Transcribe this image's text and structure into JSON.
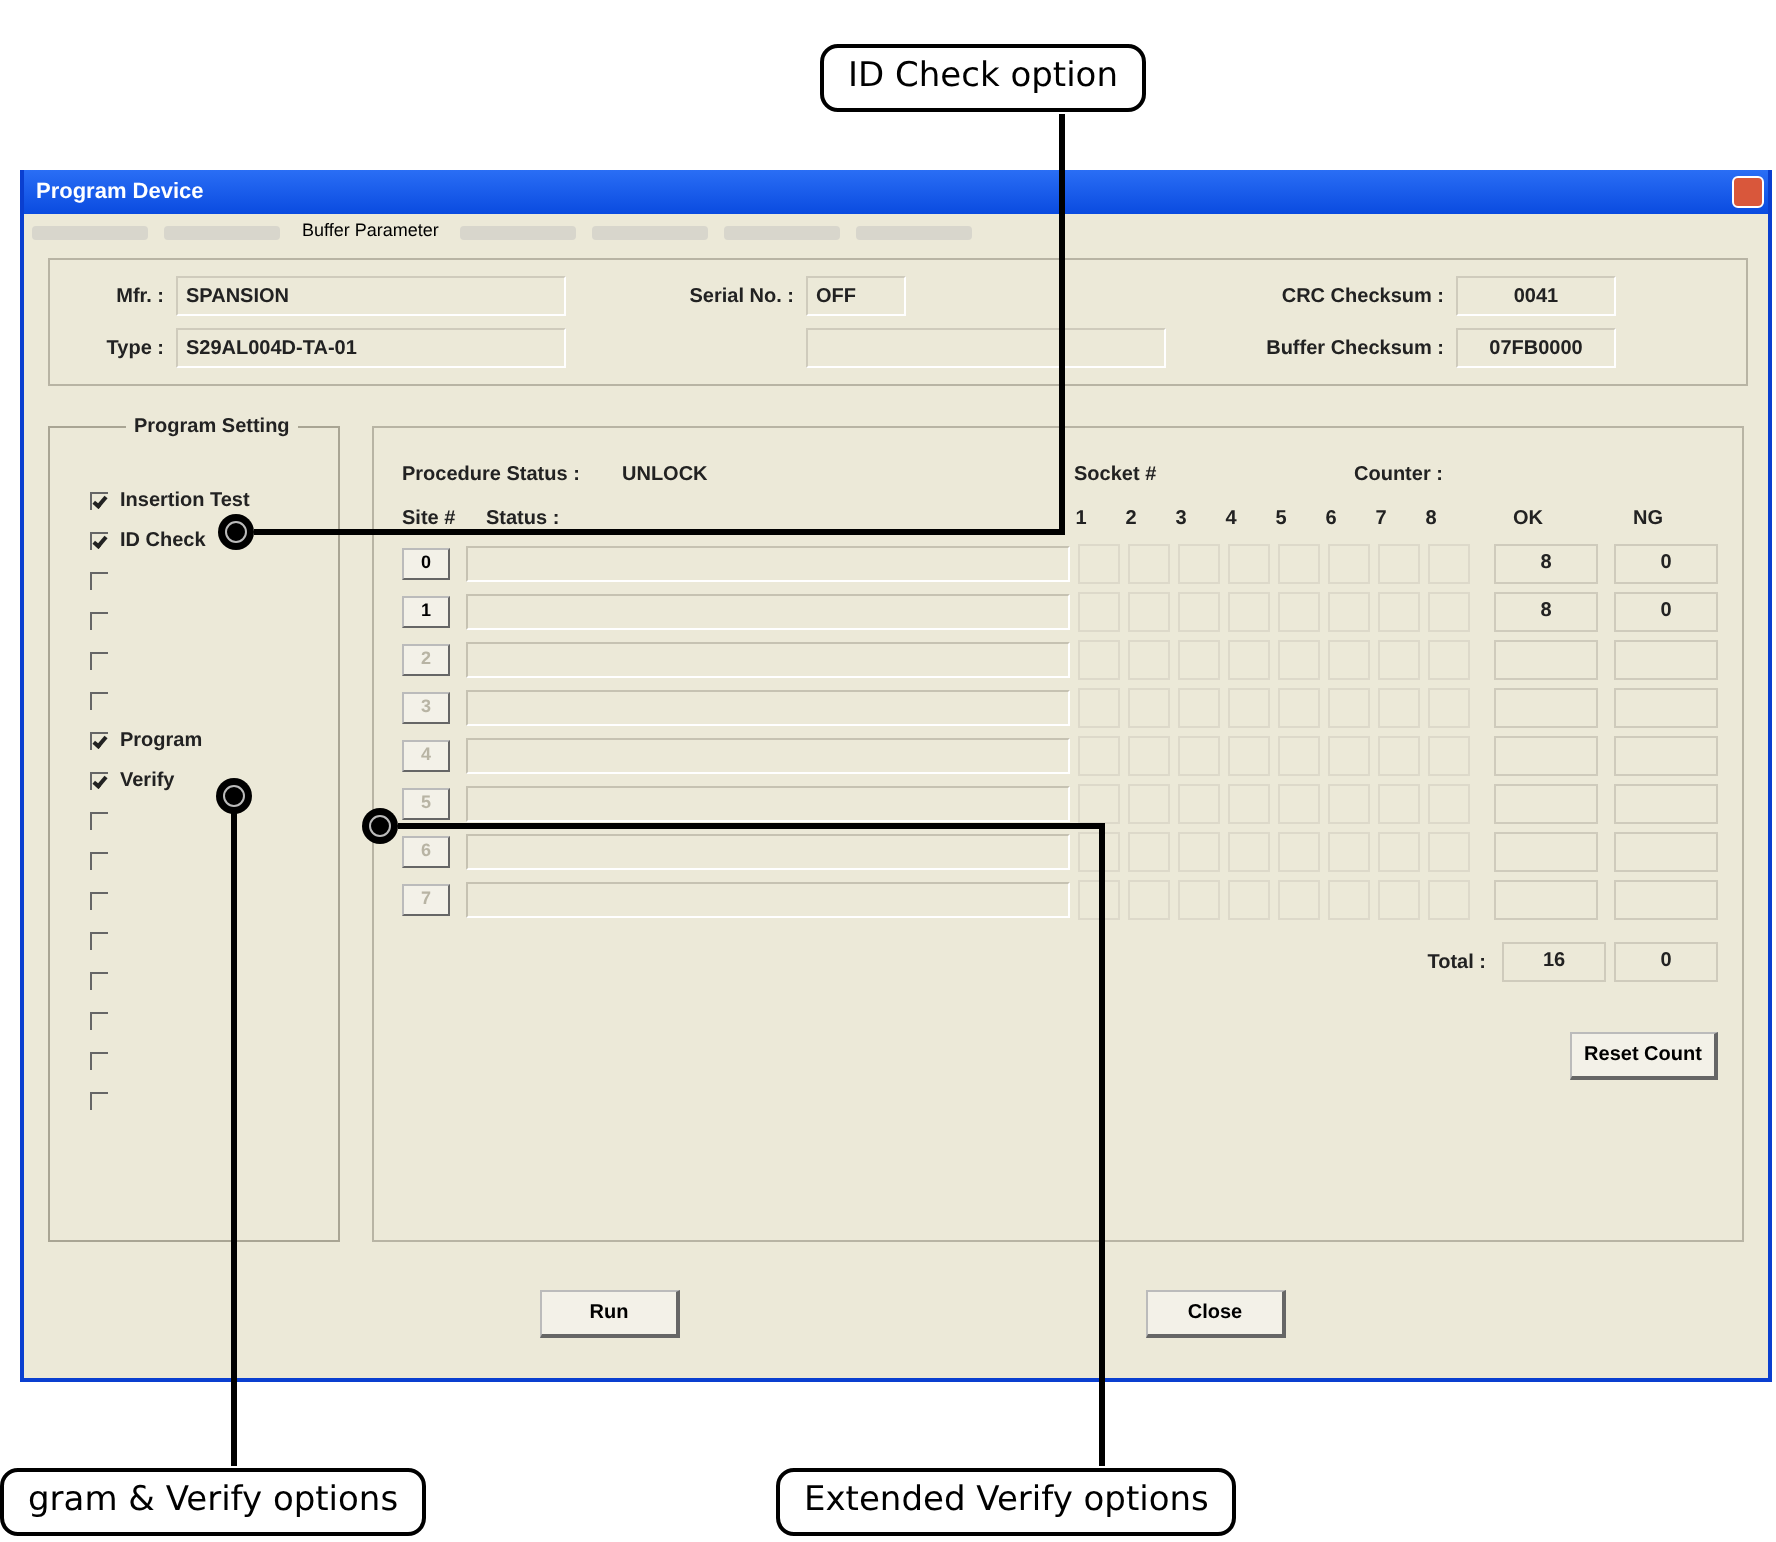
{
  "window": {
    "title": "Program Device"
  },
  "tabs": [
    {
      "kind": "blurred",
      "selected": false
    },
    {
      "kind": "blurred",
      "selected": false
    },
    {
      "kind": "text",
      "label": "Buffer Parameter",
      "selected": true
    },
    {
      "kind": "blurred",
      "selected": false
    },
    {
      "kind": "blurred",
      "selected": false
    },
    {
      "kind": "blurred",
      "selected": false
    },
    {
      "kind": "blurred",
      "selected": false
    }
  ],
  "device_info": {
    "mfr": {
      "label": "Mfr. :",
      "value": "SPANSION"
    },
    "type": {
      "label": "Type :",
      "value": "S29AL004D-TA-01"
    },
    "serial": {
      "label": "Serial No. :",
      "value": "OFF"
    },
    "crc": {
      "label": "CRC Checksum :",
      "value": "0041"
    },
    "buffer": {
      "label": "Buffer Checksum :",
      "value": "07FB0000"
    }
  },
  "program_setting": {
    "title": "Program Setting",
    "options": [
      {
        "label": "Insertion Test",
        "checked": true
      },
      {
        "label": "ID Check",
        "checked": true
      },
      {
        "checked": false
      },
      {
        "checked": false
      },
      {
        "checked": false
      },
      {
        "checked": false
      },
      {
        "label": "Program",
        "checked": true
      },
      {
        "label": "Verify",
        "checked": true
      },
      {
        "checked": false
      },
      {
        "checked": false
      },
      {
        "checked": false
      },
      {
        "checked": false
      },
      {
        "checked": false
      },
      {
        "checked": false
      },
      {
        "checked": false
      },
      {
        "checked": false
      }
    ]
  },
  "procedure_status": {
    "label": "Procedure Status :",
    "value": "UNLOCK"
  },
  "socket_header": "Socket #",
  "counter_header": "Counter :",
  "columns": {
    "site": "Site #",
    "status": "Status :",
    "sockets": [
      "1",
      "2",
      "3",
      "4",
      "5",
      "6",
      "7",
      "8"
    ],
    "ok": "OK",
    "ng": "NG"
  },
  "sites": [
    {
      "label": "0",
      "disabled": false,
      "ok": "8",
      "ng": "0"
    },
    {
      "label": "1",
      "disabled": false,
      "ok": "8",
      "ng": "0"
    },
    {
      "label": "2",
      "disabled": true
    },
    {
      "label": "3",
      "disabled": true
    },
    {
      "label": "4",
      "disabled": true
    },
    {
      "label": "5",
      "disabled": true
    },
    {
      "label": "6",
      "disabled": true
    },
    {
      "label": "7",
      "disabled": true
    }
  ],
  "total": {
    "label": "Total :",
    "ok": "16",
    "ng": "0"
  },
  "reset_button": "Reset Count",
  "buttons": [
    "Run",
    "Close"
  ],
  "annotations": [
    {
      "text": "ID Check option"
    },
    {
      "text": "gram & Verify options"
    },
    {
      "text": "Extended Verify options"
    }
  ]
}
